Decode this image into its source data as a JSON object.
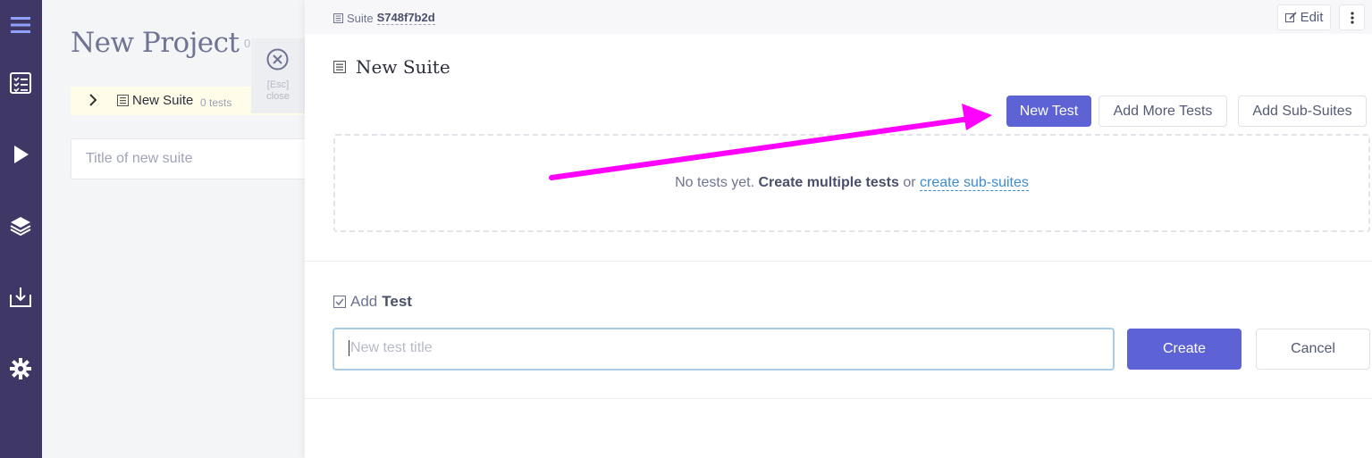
{
  "nav": {
    "items": [
      {
        "icon": "menu-icon"
      },
      {
        "icon": "checklist-icon"
      },
      {
        "icon": "play-icon"
      },
      {
        "icon": "layers-icon"
      },
      {
        "icon": "import-icon"
      },
      {
        "icon": "gear-icon"
      }
    ]
  },
  "project": {
    "title": "New Project",
    "count": "0 tests",
    "tree": {
      "suite_name": "New Suite",
      "suite_count": "0 tests"
    },
    "new_suite_placeholder": "Title of new suite",
    "close": {
      "line1": "[Esc]",
      "line2": "close"
    }
  },
  "panel": {
    "breadcrumb_label": "Suite",
    "suite_id": "S748f7b2d",
    "edit_label": "Edit",
    "title": "New Suite",
    "buttons": {
      "new_test": "New Test",
      "add_more_tests": "Add More Tests",
      "add_sub_suites": "Add Sub-Suites"
    },
    "empty": {
      "prefix": "No tests yet.",
      "bold": "Create multiple tests",
      "middle": "or",
      "link": "create sub-suites"
    },
    "add_test": {
      "prefix": "Add",
      "bold": "Test"
    },
    "test_input_placeholder": "New test title",
    "create_label": "Create",
    "cancel_label": "Cancel"
  },
  "colors": {
    "nav_bg": "#3f3765",
    "primary": "#5d62d4",
    "annotation_arrow": "#ff00ff",
    "link": "#3d8bd1"
  }
}
